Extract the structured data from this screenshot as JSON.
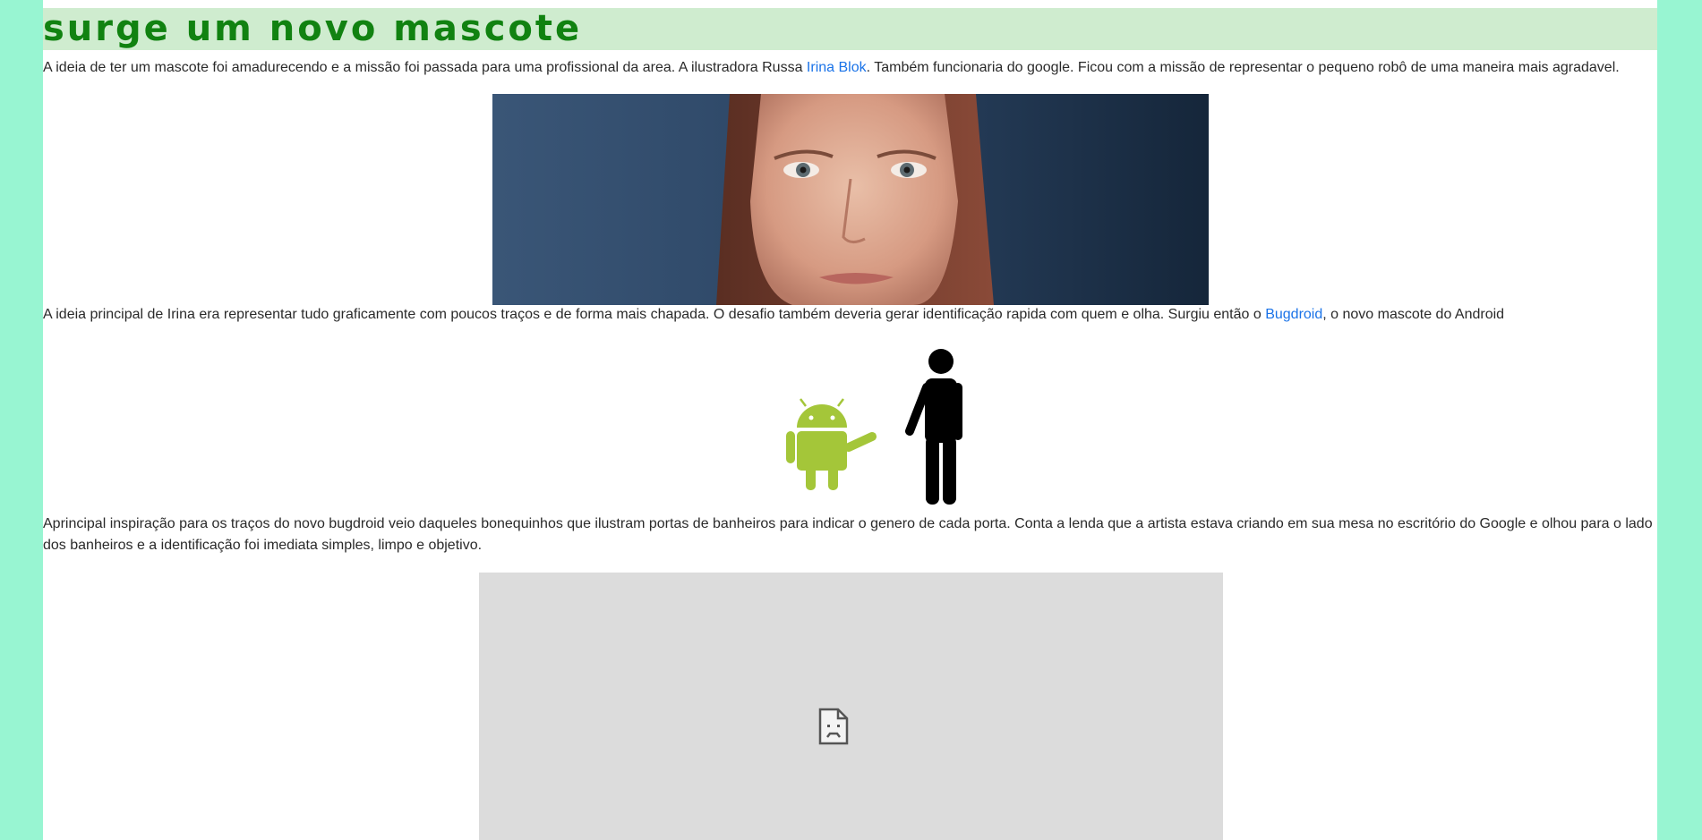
{
  "section": {
    "title": "Surge um novo mascote"
  },
  "paragraph1": {
    "before": "A ideia de ter um mascote foi amadurecendo e a missão foi passada para uma profissional da area. A ilustradora Russa ",
    "link": "Irina Blok",
    "after": ". Também funcionaria do google. Ficou com a missão de representar o pequeno robô de uma maneira mais agradavel."
  },
  "paragraph2": {
    "before": "A ideia principal de Irina era representar tudo graficamente com poucos traços e de forma mais chapada. O desafio também deveria gerar identificação rapida com quem e olha. Surgiu então o ",
    "link": "Bugdroid",
    "after": ", o novo mascote do Android"
  },
  "paragraph3": {
    "text": "Aprincipal inspiração para os traços do novo bugdroid veio daqueles bonequinhos que ilustram portas de banheiros para indicar o genero de cada porta. Conta a lenda que a artista estava criando em sua mesa no escritório do Google e olhou para o lado dos banheiros e a identificação foi imediata simples, limpo e objetivo."
  },
  "images": {
    "portrait_icon": "portrait-photo",
    "mascot_icon": "android-holding-hands-icon",
    "broken_icon": "broken-image-icon"
  },
  "colors": {
    "page_background": "#98f5d2",
    "heading_bar": "#cfeccf",
    "heading_text": "#118211",
    "link": "#1a73e8",
    "android_green": "#a4c639"
  }
}
